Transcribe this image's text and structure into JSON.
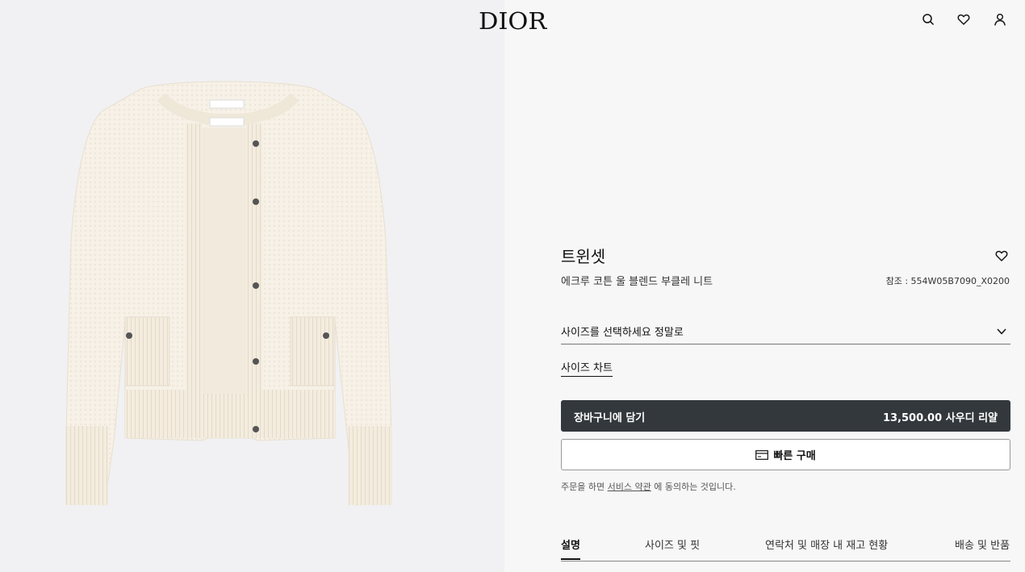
{
  "brand": {
    "logo_text": "DIOR"
  },
  "header": {
    "icons": [
      "search-icon",
      "heart-icon",
      "user-icon"
    ]
  },
  "product": {
    "title": "트윈셋",
    "subtitle": "에크루 코튼 울 블렌드 부클레 니트",
    "reference": "참조 : 554W05B7090_X0200",
    "size_select_label": "사이즈를 선택하세요 정말로",
    "size_chart_label": "사이즈 차트",
    "add_to_cart_label": "장바구니에 담기",
    "price": "13,500.00 사우디 리얄",
    "quick_buy_label": "빠른 구매",
    "colors": {
      "primary_button": "#33383c",
      "image_bg": "#f1f1f3",
      "garment": "#f6f0e6"
    }
  },
  "terms": {
    "prefix": "주문을 하면",
    "link": "서비스 약관",
    "suffix": "에 동의하는 것입니다."
  },
  "tabs": [
    {
      "label": "설명",
      "active": true
    },
    {
      "label": "사이즈 및 핏",
      "active": false
    },
    {
      "label": "연락처 및 매장 내 재고 현황",
      "active": false
    },
    {
      "label": "배송 및 반품",
      "active": false
    }
  ]
}
